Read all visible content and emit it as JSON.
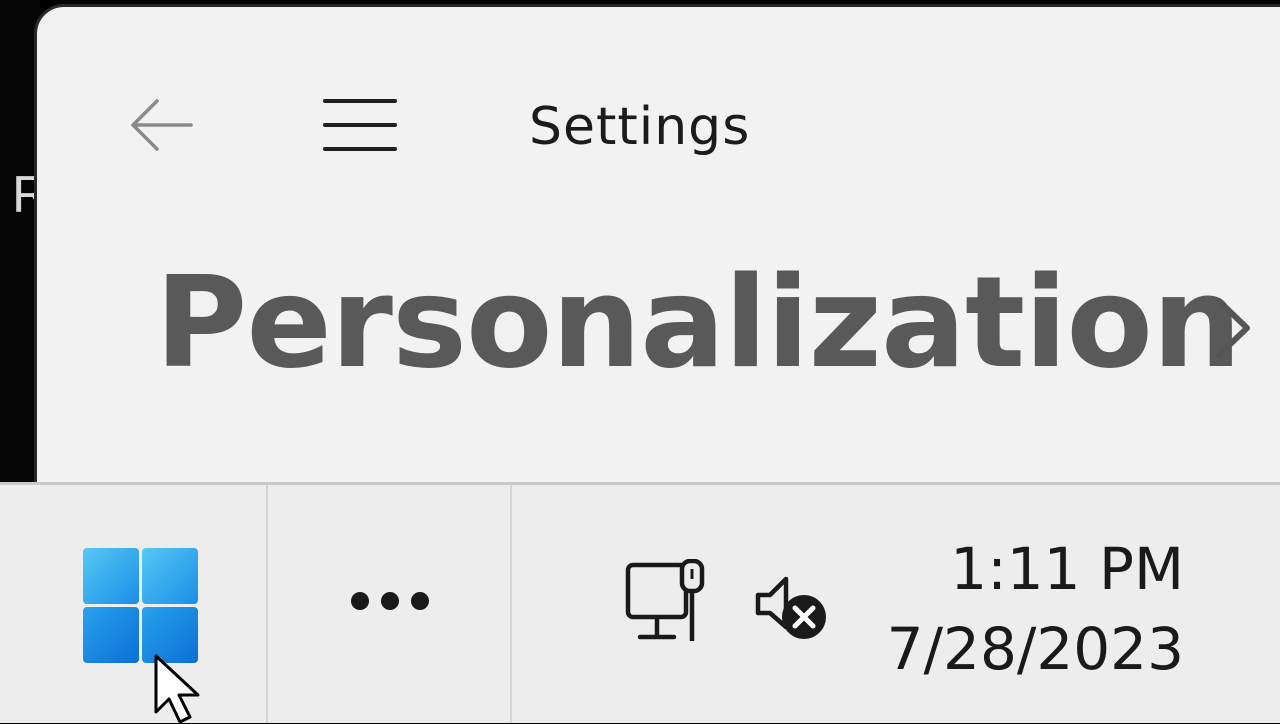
{
  "background_window": {
    "partial_letter": "R"
  },
  "window": {
    "title": "Settings",
    "heading": "Personalization"
  },
  "icons": {
    "back": "back-arrow-icon",
    "menu": "hamburger-menu-icon",
    "chevron": "chevron-right-icon",
    "start": "windows-start-icon",
    "overflow": "more-dots-icon",
    "network": "wired-network-icon",
    "volume": "speaker-muted-icon",
    "cursor": "mouse-pointer-icon"
  },
  "taskbar": {
    "time": "1:11 PM",
    "date": "7/28/2023"
  },
  "colors": {
    "window_bg": "#f2f2f2",
    "taskbar_bg": "#ededed",
    "heading": "#595959",
    "start_blue": "#1a8ee6"
  }
}
